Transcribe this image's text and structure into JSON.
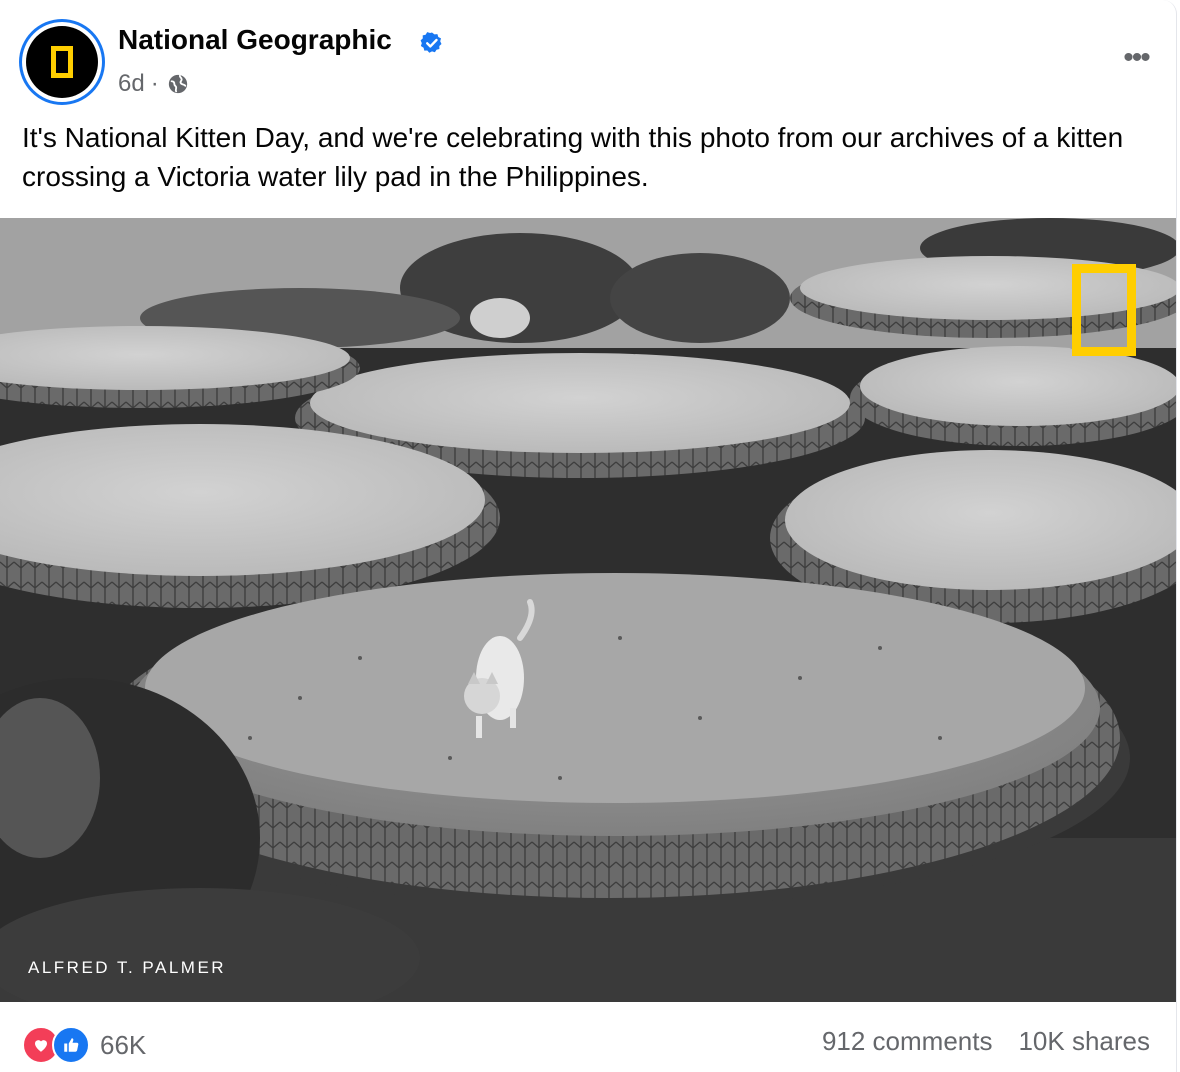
{
  "post": {
    "page_name": "National Geographic",
    "verified_icon": "verified-badge-icon",
    "time": "6d",
    "separator": "·",
    "audience_icon": "globe-icon",
    "more_icon": "more-horizontal-icon",
    "more_label": "•••",
    "text": "It's National Kitten Day, and we're celebrating with this photo from our archives of a kitten crossing a Victoria water lily pad in the Philippines."
  },
  "photo": {
    "credit": "ALFRED T. PALMER",
    "logo": "national-geographic-yellow-border-logo",
    "colors": {
      "logo_yellow": "#ffce00"
    }
  },
  "footer": {
    "reaction_icons": [
      "love-icon",
      "like-icon"
    ],
    "reaction_count": "66K",
    "comments": "912 comments",
    "shares": "10K shares"
  },
  "colors": {
    "verified_blue": "#1877f2",
    "love_red": "#f33e58",
    "secondary_text": "#65676b"
  }
}
